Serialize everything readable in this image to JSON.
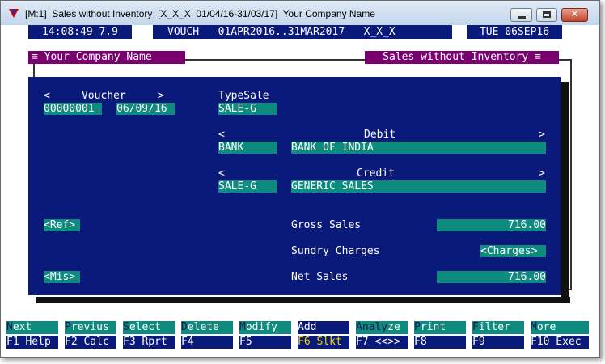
{
  "window": {
    "title": "[M:1]  Sales without Inventory  [X_X_X  01/04/16-31/03/17]  Your Company Name",
    "min_label": "",
    "max_label": "",
    "close_label": "✕"
  },
  "status_bar": {
    "time": "14:08:49 7.9",
    "mode": "VOUCH   01APR2016..31MAR2017   X_X_X",
    "date": "TUE 06SEP16"
  },
  "panels": {
    "left_title": "≡ Your Company Name",
    "right_title": "Sales without Inventory ≡"
  },
  "form": {
    "voucher_header": "<     Voucher     >",
    "voucher_no": "00000001",
    "voucher_date": "06/09/16",
    "typesale_label": "TypeSale",
    "typesale_value": "SALE-G",
    "debit_header_left": "<",
    "debit_header": "Debit",
    "debit_header_right": ">",
    "debit_code": "BANK",
    "debit_name": "BANK OF INDIA",
    "credit_header_left": "<",
    "credit_header": "Credit",
    "credit_header_right": ">",
    "credit_code": "SALE-G",
    "credit_name": "GENERIC SALES",
    "ref_button": "<Ref>",
    "mis_button": "<Mis>",
    "gross_sales_label": "Gross Sales",
    "gross_sales_value": "716.00",
    "sundry_charges_label": "Sundry Charges",
    "charges_button": "<Charges>",
    "net_sales_label": "Net Sales",
    "net_sales_value": "716.00"
  },
  "function_keys": {
    "top": [
      {
        "hot": "N",
        "rest": "ext"
      },
      {
        "hot": "P",
        "rest": "revius"
      },
      {
        "hot": "S",
        "rest": "elect"
      },
      {
        "hot": "D",
        "rest": "elete"
      },
      {
        "hot": "M",
        "rest": "odify"
      },
      {
        "hot": "",
        "rest": "Add"
      },
      {
        "hot": "Analy",
        "rest": "ze"
      },
      {
        "hot": "P",
        "rest": "rint"
      },
      {
        "hot": "F",
        "rest": "ilter"
      },
      {
        "hot": "M",
        "rest": "ore"
      }
    ],
    "bottom": [
      {
        "key": "F1",
        "label": " Help"
      },
      {
        "key": "F2",
        "label": " Calc"
      },
      {
        "key": "F3",
        "label": " Rprt"
      },
      {
        "key": "F4",
        "label": ""
      },
      {
        "key": "F5",
        "label": ""
      },
      {
        "key": "F6",
        "label": " Slkt"
      },
      {
        "key": "F7",
        "label": " <<>>"
      },
      {
        "key": "F8",
        "label": ""
      },
      {
        "key": "F9",
        "label": ""
      },
      {
        "key": "F10",
        "label": " Exec"
      }
    ]
  },
  "colors": {
    "navy": "#0a1a7a",
    "teal": "#0e8a7e",
    "purple": "#7a0070",
    "yellow": "#f5d400"
  }
}
